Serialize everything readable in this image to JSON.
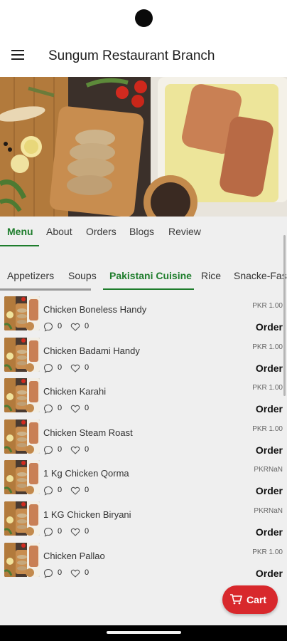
{
  "app_bar": {
    "title": "Sungum Restaurant Branch",
    "menu_icon": "hamburger-menu-icon"
  },
  "main_tabs": [
    "Menu",
    "About",
    "Orders",
    "Blogs",
    "Review"
  ],
  "category_tabs": [
    "Appetizers",
    "Soups",
    "Pakistani Cuisine",
    "Rice",
    "Snacke-Fast"
  ],
  "items": [
    {
      "name": "Chicken Boneless Handy",
      "price": "PKR 1.00",
      "comments": "0",
      "likes": "0",
      "order": "Order"
    },
    {
      "name": "Chicken Badami Handy",
      "price": "PKR 1.00",
      "comments": "0",
      "likes": "0",
      "order": "Order"
    },
    {
      "name": "Chicken Karahi",
      "price": "PKR 1.00",
      "comments": "0",
      "likes": "0",
      "order": "Order"
    },
    {
      "name": "Chicken Steam Roast",
      "price": "PKR 1.00",
      "comments": "0",
      "likes": "0",
      "order": "Order"
    },
    {
      "name": "1 Kg Chicken Qorma",
      "price": "PKRNaN",
      "comments": "0",
      "likes": "0",
      "order": "Order"
    },
    {
      "name": "1 KG Chicken Biryani",
      "price": "PKRNaN",
      "comments": "0",
      "likes": "0",
      "order": "Order"
    },
    {
      "name": "Chicken Pallao",
      "price": "PKR 1.00",
      "comments": "0",
      "likes": "0",
      "order": "Order"
    }
  ],
  "cart": {
    "label": "Cart",
    "icon": "cart-icon"
  },
  "colors": {
    "accent": "#1e7d2c",
    "cart": "#d8282c",
    "background": "#efefef"
  }
}
